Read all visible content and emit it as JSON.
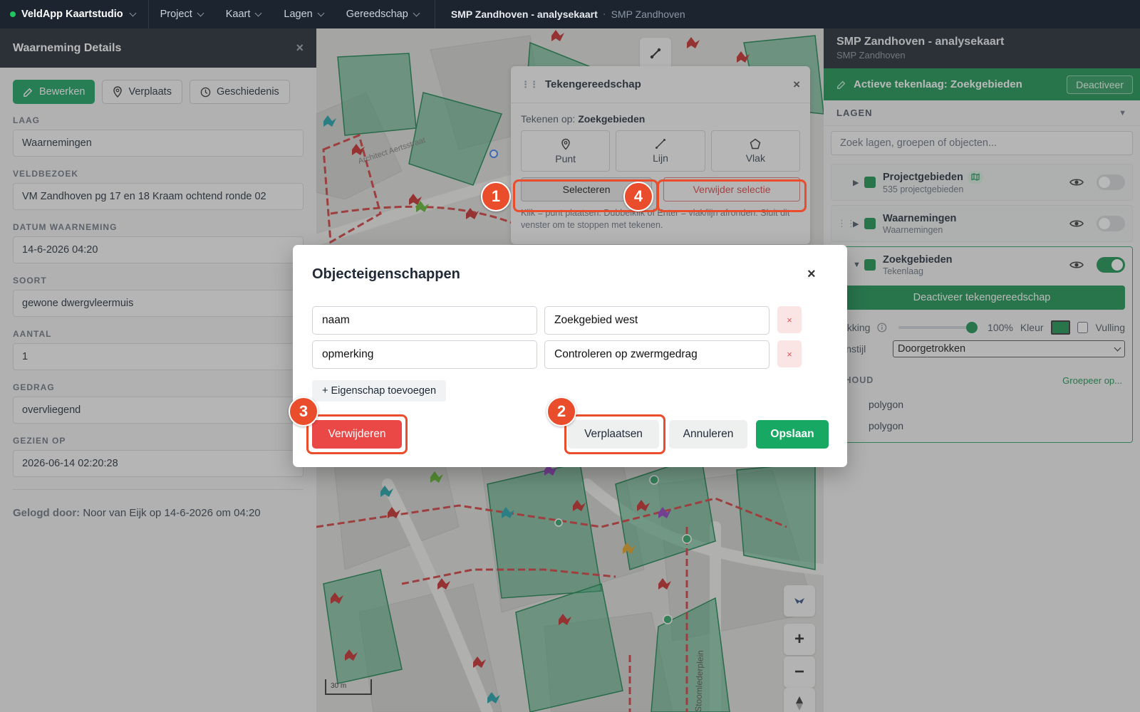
{
  "topbar": {
    "app_name": "VeldApp Kaartstudio",
    "menus": [
      "Project",
      "Kaart",
      "Lagen",
      "Gereedschap"
    ],
    "project_title": "SMP Zandhoven - analysekaart",
    "separator": "·",
    "project_sub": "SMP Zandhoven"
  },
  "left_panel": {
    "title": "Waarneming Details",
    "close": "×",
    "actions": {
      "edit": "Bewerken",
      "move": "Verplaats",
      "history": "Geschiedenis"
    },
    "fields": [
      {
        "label": "LAAG",
        "value": "Waarnemingen"
      },
      {
        "label": "VELDBEZOEK",
        "value": "VM Zandhoven pg 17 en 18 Kraam ochtend ronde 02"
      },
      {
        "label": "DATUM WAARNEMING",
        "value": "14-6-2026 04:20"
      },
      {
        "label": "SOORT",
        "value": "gewone dwergvleermuis"
      },
      {
        "label": "AANTAL",
        "value": "1"
      },
      {
        "label": "GEDRAG",
        "value": "overvliegend"
      },
      {
        "label": "GEZIEN OP",
        "value": "2026-06-14 02:20:28"
      }
    ],
    "logged_label": "Gelogd door:",
    "logged_value": "Noor van Eijk op 14-6-2026 om 04:20"
  },
  "tool_panel": {
    "title": "Tekengereedschap",
    "close": "×",
    "draw_on_label": "Tekenen op:",
    "draw_on_value": "Zoekgebieden",
    "modes": [
      "Punt",
      "Lijn",
      "Vlak"
    ],
    "select": "Selecteren",
    "delete_selection": "Verwijder selectie",
    "hint": "Klik = punt plaatsen. Dubbelklik of Enter = vlak/lijn afronden. Sluit dit venster om te stoppen met tekenen."
  },
  "map": {
    "scale": "30 m",
    "street": "Stoomlederplein",
    "street2": "Architect Aertsstraat"
  },
  "right_panel": {
    "title": "SMP Zandhoven - analysekaart",
    "subtitle": "SMP Zandhoven",
    "active_layer": "Actieve tekenlaag: Zoekgebieden",
    "deactivate": "Deactiveer",
    "layers_heading": "LAGEN",
    "search_placeholder": "Zoek lagen, groepen of objecten...",
    "layers": [
      {
        "name": "Projectgebieden",
        "sub": "535 projectgebieden",
        "on": false
      },
      {
        "name": "Waarnemingen",
        "sub": "Waarnemingen",
        "on": false
      },
      {
        "name": "Zoekgebieden",
        "sub": "Tekenlaag",
        "on": true
      }
    ],
    "deactivate_tool": "Deactiveer tekengereedschap",
    "opacity_label": "ekking",
    "opacity_value": "100%",
    "color_label": "Kleur",
    "fill_label": "Vulling",
    "line_style_label": "ijnstijl",
    "line_style_value": "Doorgetrokken",
    "content_heading": "IHOUD",
    "group_by": "Groepeer op...",
    "items": [
      "polygon",
      "polygon"
    ]
  },
  "modal": {
    "title": "Objecteigenschappen",
    "close": "×",
    "properties": [
      {
        "key": "naam",
        "value": "Zoekgebied west",
        "remove": "×"
      },
      {
        "key": "opmerking",
        "value": "Controleren op zwermgedrag",
        "remove": "×"
      }
    ],
    "add_property": "+ Eigenschap toevoegen",
    "delete": "Verwijderen",
    "move": "Verplaatsen",
    "cancel": "Annuleren",
    "save": "Opslaan"
  },
  "callouts": [
    "1",
    "2",
    "3",
    "4"
  ],
  "colors": {
    "accent_green": "#16a05c",
    "danger": "#ea4747",
    "callout": "#ea4d2c",
    "dark_bar": "#1c2430"
  }
}
